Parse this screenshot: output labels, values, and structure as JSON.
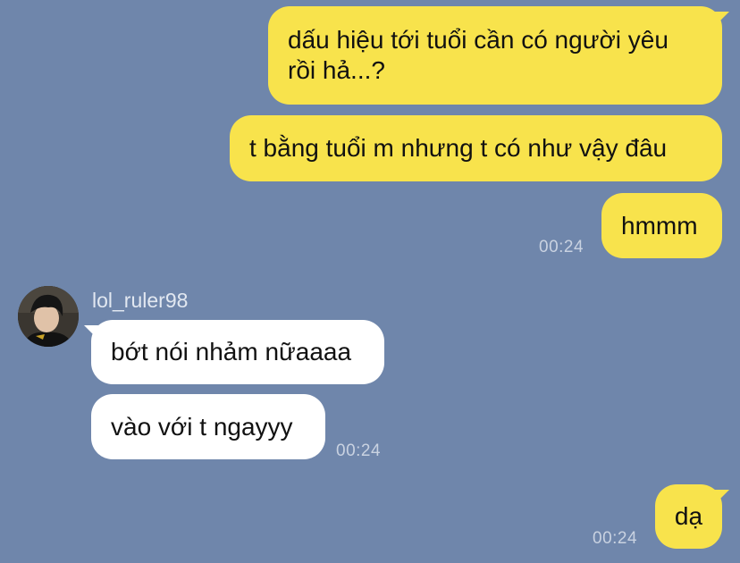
{
  "messages": [
    {
      "text": "dấu hiệu tới tuổi cần có người yêu\nrồi hả...?"
    },
    {
      "text": "t bằng tuổi m nhưng t có như vậy đâu"
    },
    {
      "text": "hmmm",
      "time": "00:24"
    },
    {
      "text": "bớt nói nhảm nữaaaa"
    },
    {
      "text": "vào với t ngayyy",
      "time": "00:24"
    },
    {
      "text": "dạ",
      "time": "00:24"
    }
  ],
  "contact": {
    "name": "lol_ruler98",
    "avatar_icon": "profile-photo"
  },
  "colors": {
    "background": "#6f86ab",
    "outgoing": "#f8e34c",
    "incoming": "#ffffff"
  }
}
